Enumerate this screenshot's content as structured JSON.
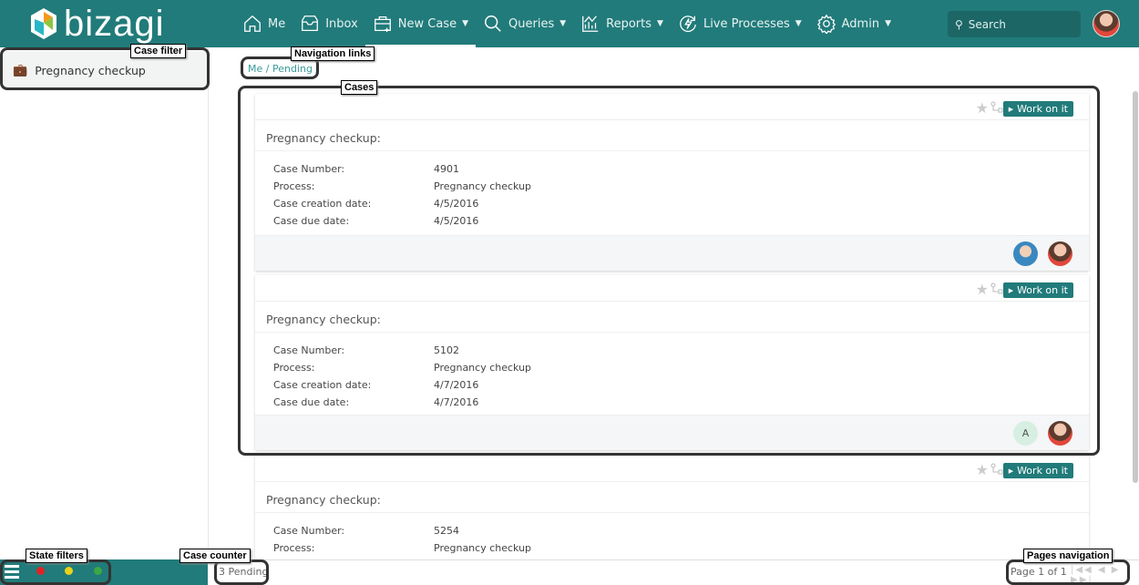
{
  "header": {
    "logo": "bizagi",
    "search_placeholder": "Search",
    "nav": [
      {
        "label": "Me",
        "icon": "home-icon"
      },
      {
        "label": "Inbox",
        "icon": "inbox-icon"
      },
      {
        "label": "New Case",
        "icon": "new-case-icon",
        "dropdown": true
      },
      {
        "label": "Queries",
        "icon": "search-icon",
        "dropdown": true
      },
      {
        "label": "Reports",
        "icon": "chart-icon",
        "dropdown": true
      },
      {
        "label": "Live Processes",
        "icon": "lightning-icon",
        "dropdown": true
      },
      {
        "label": "Admin",
        "icon": "gear-icon",
        "dropdown": true
      }
    ]
  },
  "sidebar": {
    "filter": "Pregnancy checkup"
  },
  "breadcrumb": {
    "me": "Me /",
    "pending": "Pending /"
  },
  "labels": {
    "case_number": "Case Number:",
    "process": "Process:",
    "creation": "Case creation date:",
    "due": "Case due date:",
    "work": "Work on it",
    "avatar_letter": "A"
  },
  "cases": [
    {
      "title": "Pregnancy checkup:",
      "number": "4901",
      "process": "Pregnancy checkup",
      "created": "4/5/2016",
      "due": "4/5/2016"
    },
    {
      "title": "Pregnancy checkup:",
      "number": "5102",
      "process": "Pregnancy checkup",
      "created": "4/7/2016",
      "due": "4/7/2016"
    },
    {
      "title": "Pregnancy checkup:",
      "number": "5254",
      "process": "Pregnancy checkup"
    }
  ],
  "footer": {
    "counter": "3 Pending",
    "pager": "Page 1 of 1",
    "pager_controls": "|◀◀ ◀ ▶ ▶▶|",
    "state_colors": [
      "#e02424",
      "#e8d21a",
      "#3aa845"
    ]
  },
  "annotations": {
    "case_filter": "Case filter",
    "navigation": "Navigation links",
    "cases": "Cases",
    "state_filters": "State filters",
    "case_counter": "Case counter",
    "pages_navigation": "Pages navigation"
  },
  "colors": {
    "brand": "#217b7a"
  }
}
